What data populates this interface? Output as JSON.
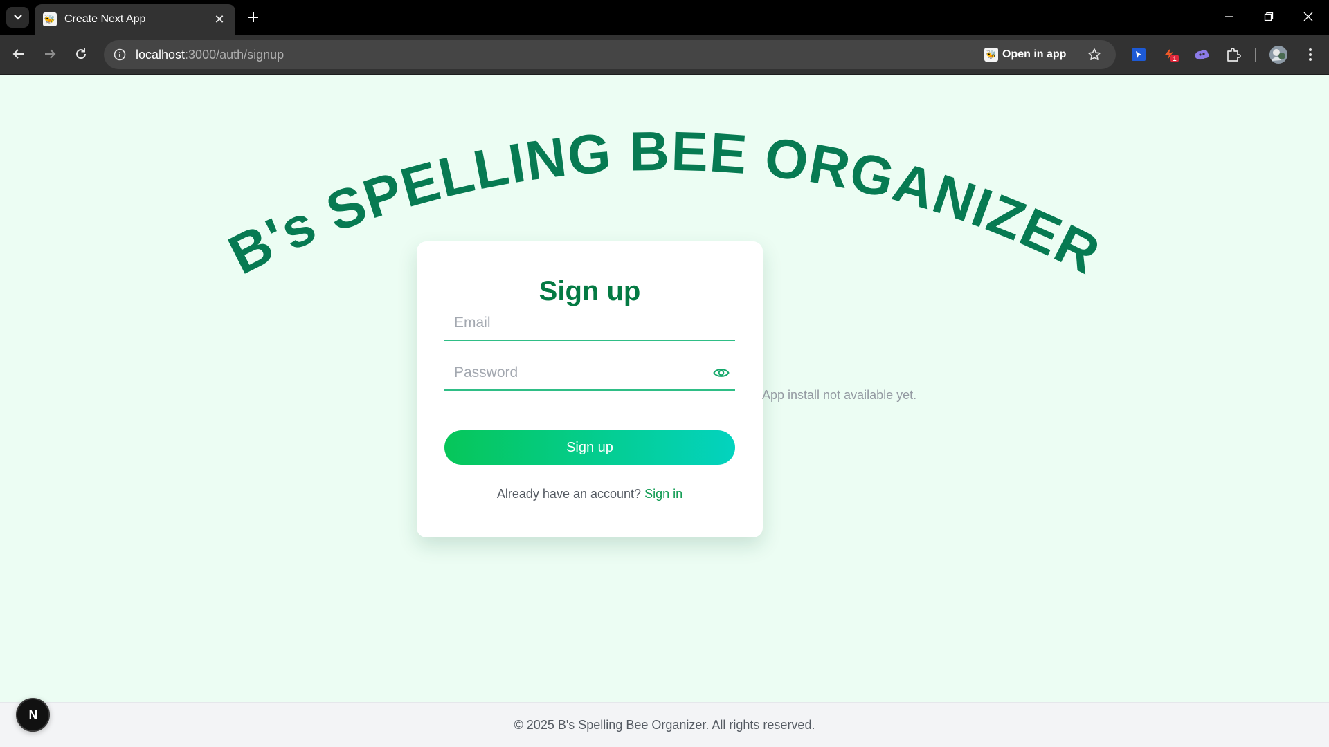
{
  "browser": {
    "tab_title": "Create Next App",
    "tab_favicon": "bee-icon",
    "url_host": "localhost",
    "url_path": ":3000/auth/signup",
    "open_in_app_label": "Open in app",
    "extension_badge_count": "1"
  },
  "page": {
    "arc_title": "B's SPELLING BEE ORGANIZER",
    "arc_title_color": "#077a52",
    "background_color": "#ecfdf3"
  },
  "form": {
    "heading": "Sign up",
    "email_placeholder": "Email",
    "email_value": "",
    "password_placeholder": "Password",
    "password_value": "",
    "submit_label": "Sign up",
    "signin_prompt": "Already have an account?",
    "signin_link": "Sign in",
    "accent_color": "#047a43"
  },
  "install_note": "App install not available yet.",
  "footer": {
    "text": "© 2025 B's Spelling Bee Organizer. All rights reserved."
  },
  "dev_badge": "N"
}
